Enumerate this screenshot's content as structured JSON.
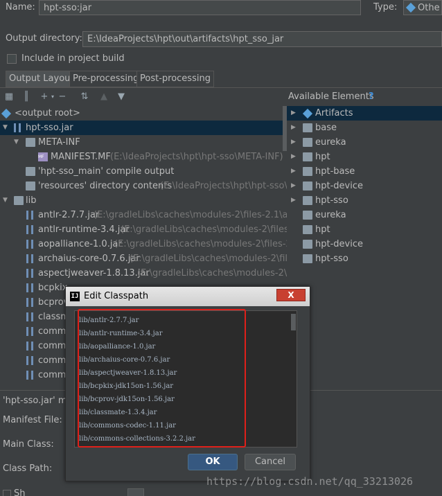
{
  "header": {
    "name_label": "Name:",
    "name_value": "hpt-sso:jar",
    "type_label": "Type:",
    "type_value": "Othe",
    "output_dir_label": "Output directory:",
    "output_dir_value": "E:\\IdeaProjects\\hpt\\out\\artifacts\\hpt_sso_jar",
    "include_build_label": "Include in project build"
  },
  "tabs": [
    "Output Layout",
    "Pre-processing",
    "Post-processing"
  ],
  "available_elements_label": "Available Elements",
  "help_glyph": "?",
  "tree": [
    {
      "label": "<output root>",
      "path": ""
    },
    {
      "label": "hpt-sso.jar",
      "path": ""
    },
    {
      "label": "META-INF",
      "path": ""
    },
    {
      "label": "MANIFEST.MF",
      "path": "(E:\\IdeaProjects\\hpt\\hpt-sso\\META-INF)"
    },
    {
      "label": "'hpt-sso_main' compile output",
      "path": ""
    },
    {
      "label": "'resources' directory contents",
      "path": "(E:\\IdeaProjects\\hpt\\hpt-sso\\src"
    },
    {
      "label": "lib",
      "path": ""
    },
    {
      "label": "antlr-2.7.7.jar",
      "path": "(E:\\gradleLibs\\caches\\modules-2\\files-2.1\\antlr\\a"
    },
    {
      "label": "antlr-runtime-3.4.jar",
      "path": "(E:\\gradleLibs\\caches\\modules-2\\files-2.1"
    },
    {
      "label": "aopalliance-1.0.jar",
      "path": "(E:\\gradleLibs\\caches\\modules-2\\files-2.1\\a"
    },
    {
      "label": "archaius-core-0.7.6.jar",
      "path": "(E:\\gradleLibs\\caches\\modules-2\\files-2"
    },
    {
      "label": "aspectjweaver-1.8.13.jar",
      "path": "(E:\\gradleLibs\\caches\\modules-2\\files"
    },
    {
      "label": "bcpkix",
      "path": ""
    },
    {
      "label": "bcprov",
      "path": ""
    },
    {
      "label": "classm",
      "path": ""
    },
    {
      "label": "comm",
      "path": ""
    },
    {
      "label": "comm",
      "path": ""
    },
    {
      "label": "comm",
      "path": ""
    },
    {
      "label": "comm",
      "path": ""
    }
  ],
  "available": [
    "Artifacts",
    "base",
    "eureka",
    "hpt",
    "hpt-base",
    "hpt-device",
    "hpt-sso",
    "eureka",
    "hpt",
    "hpt-device",
    "hpt-sso"
  ],
  "bottom": {
    "jar_label": "'hpt-sso.jar' ma",
    "manifest_label": "Manifest File:",
    "main_class_label": "Main Class:",
    "class_path_label": "Class Path:",
    "show_label": "Sh"
  },
  "dialog": {
    "title": "Edit Classpath",
    "logo": "IJ",
    "close": "X",
    "entries": [
      "lib/antlr-2.7.7.jar",
      "lib/antlr-runtime-3.4.jar",
      "lib/aopalliance-1.0.jar",
      "lib/archaius-core-0.7.6.jar",
      "lib/aspectjweaver-1.8.13.jar",
      "lib/bcpkix-jdk15on-1.56.jar",
      "lib/bcprov-jdk15on-1.56.jar",
      "lib/classmate-1.3.4.jar",
      "lib/commons-codec-1.11.jar",
      "lib/commons-collections-3.2.2.jar"
    ],
    "ok_label": "OK",
    "cancel_label": "Cancel"
  },
  "watermark": "https://blog.csdn.net/qq_33213026",
  "colors": {
    "background": "#3c3f41",
    "selection": "#0d293e",
    "highlight_box": "#e0201a",
    "ok_button": "#365880"
  }
}
